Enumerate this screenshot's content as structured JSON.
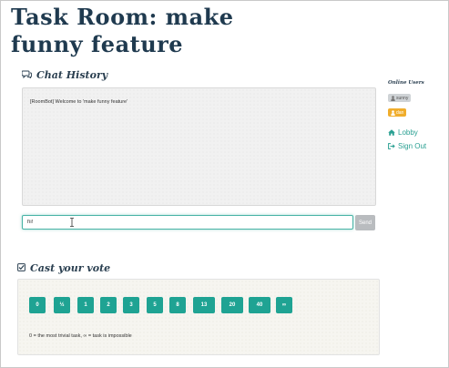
{
  "page": {
    "title": "Task Room: make funny feature"
  },
  "chat": {
    "heading": "Chat History",
    "messages": [
      "[RoomBot] Welcome to 'make funny feature'"
    ],
    "input_value": "hi!",
    "send_label": "Send"
  },
  "sidebar": {
    "online_heading": "Online Users",
    "users": [
      "sunny",
      "dan"
    ],
    "links": [
      "Lobby",
      "Sign Out"
    ]
  },
  "vote": {
    "heading": "Cast your vote",
    "cards": [
      "0",
      "½",
      "1",
      "2",
      "3",
      "5",
      "8",
      "13",
      "20",
      "40",
      "∞"
    ],
    "note": "0 = the most trivial task, ∞ = task is impossible"
  },
  "colors": {
    "accent": "#1fa393",
    "title": "#1f3a4f",
    "badge_warning": "#f0ad2c",
    "badge_default": "#cfd3d6",
    "send_disabled": "#b9bcbf"
  },
  "icons": {
    "chat": "comments-icon",
    "vote": "check-square-icon",
    "user": "user-icon",
    "lobby": "home-icon",
    "signout": "sign-out-icon"
  }
}
